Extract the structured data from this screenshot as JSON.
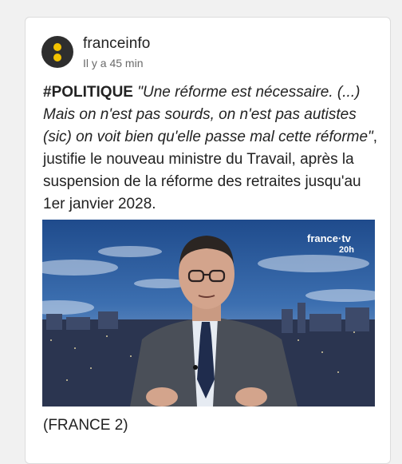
{
  "post": {
    "source_name": "franceinfo",
    "timestamp": "Il y a 45 min",
    "hashtag": "#POLITIQUE",
    "quote": "\"Une réforme est nécessaire. (...) Mais on n'est pas sourds, on n'est pas autistes (sic) on voit bien qu'elle passe mal cette réforme\"",
    "body": ", justifie le nouveau ministre du Travail, après la suspension de la réforme des retraites jusqu'au 1er janvier 2028.",
    "caption": "(FRANCE 2)"
  },
  "media": {
    "channel_logo": "france·tv",
    "show_label": "20h"
  }
}
